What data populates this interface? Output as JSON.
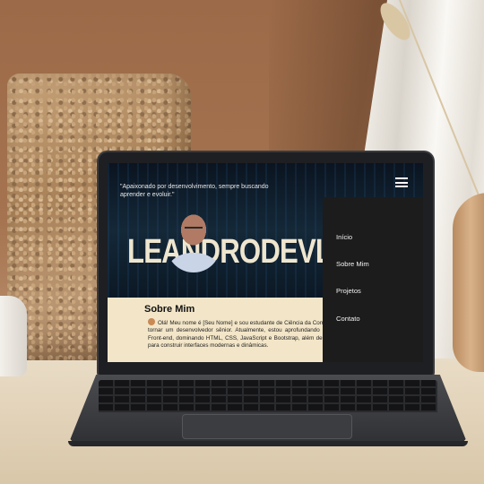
{
  "hero": {
    "quote": "\"Apaixonado por desenvolvimento, sempre buscando aprender e evoluir.\"",
    "brand": "LEANDRODEVLAB"
  },
  "nav": {
    "menu_icon": "hamburger-menu-icon",
    "items": [
      {
        "label": "Início"
      },
      {
        "label": "Sobre Mim"
      },
      {
        "label": "Projetos"
      },
      {
        "label": "Contato"
      }
    ]
  },
  "about": {
    "title": "Sobre Mim",
    "text": "Olá! Meu nome é [Seu Nome] e sou estudante de Ciência da Computação com foco em me tornar um desenvolvedor sênior. Atualmente, estou aprofundando meus conhecimentos em Front-end, dominando HTML, CSS, JavaScript e Bootstrap, além de explorar React e Angular para construir interfaces modernas e dinâmicas."
  },
  "colors": {
    "nav_bg": "#1c1c1c",
    "about_bg": "#f3e6c8",
    "brand_text": "#efe6cf"
  }
}
